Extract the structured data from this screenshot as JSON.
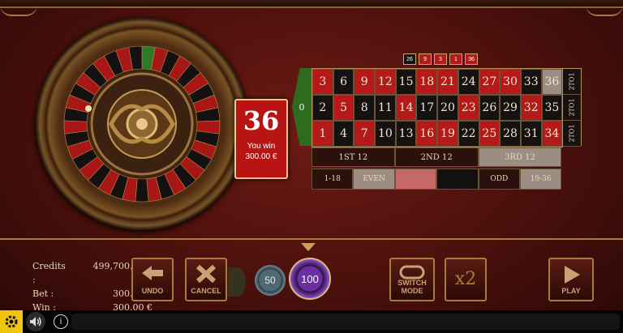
{
  "result": {
    "number": "36",
    "message": "You win",
    "amount": "300.00 €"
  },
  "history": [
    {
      "value": "26",
      "color": "#161211"
    },
    {
      "value": "9",
      "color": "#b51a1a"
    },
    {
      "value": "3",
      "color": "#b51a1a"
    },
    {
      "value": "1",
      "color": "#b51a1a"
    },
    {
      "value": "36",
      "color": "#b51a1a"
    }
  ],
  "table": {
    "zero": "0",
    "rows": [
      [
        {
          "n": "3",
          "c": "red"
        },
        {
          "n": "6",
          "c": "black"
        },
        {
          "n": "9",
          "c": "red"
        },
        {
          "n": "12",
          "c": "red"
        },
        {
          "n": "15",
          "c": "black"
        },
        {
          "n": "18",
          "c": "red"
        },
        {
          "n": "21",
          "c": "red"
        },
        {
          "n": "24",
          "c": "black"
        },
        {
          "n": "27",
          "c": "red"
        },
        {
          "n": "30",
          "c": "red"
        },
        {
          "n": "33",
          "c": "black"
        },
        {
          "n": "36",
          "c": "win"
        }
      ],
      [
        {
          "n": "2",
          "c": "black"
        },
        {
          "n": "5",
          "c": "red"
        },
        {
          "n": "8",
          "c": "black"
        },
        {
          "n": "11",
          "c": "black"
        },
        {
          "n": "14",
          "c": "red"
        },
        {
          "n": "17",
          "c": "black"
        },
        {
          "n": "20",
          "c": "black"
        },
        {
          "n": "23",
          "c": "red"
        },
        {
          "n": "26",
          "c": "black"
        },
        {
          "n": "29",
          "c": "black"
        },
        {
          "n": "32",
          "c": "red"
        },
        {
          "n": "35",
          "c": "black"
        }
      ],
      [
        {
          "n": "1",
          "c": "red"
        },
        {
          "n": "4",
          "c": "black"
        },
        {
          "n": "7",
          "c": "red"
        },
        {
          "n": "10",
          "c": "black"
        },
        {
          "n": "13",
          "c": "black"
        },
        {
          "n": "16",
          "c": "red"
        },
        {
          "n": "19",
          "c": "red"
        },
        {
          "n": "22",
          "c": "black"
        },
        {
          "n": "25",
          "c": "red"
        },
        {
          "n": "28",
          "c": "black"
        },
        {
          "n": "31",
          "c": "black"
        },
        {
          "n": "34",
          "c": "red"
        }
      ]
    ],
    "columns": [
      "2TO1",
      "2TO1",
      "2TO1"
    ],
    "dozens": [
      "1ST 12",
      "2ND 12",
      "3RD 12"
    ],
    "outside": [
      "1-18",
      "EVEN",
      "",
      "",
      "ODD",
      "19-36"
    ]
  },
  "stats": {
    "credits_label": "Credits :",
    "credits_value": "499,700.00 €",
    "bet_label": "Bet :",
    "bet_value": "300.00 €",
    "win_label": "Win :",
    "win_value": "300.00 €"
  },
  "controls": {
    "undo": "UNDO",
    "cancel": "CANCEL",
    "chip_50": "50",
    "chip_100": "100",
    "switch": "SWITCH MODE",
    "x2": "x2",
    "play": "PLAY"
  },
  "footer": {
    "info_icon": "i"
  },
  "colors": {
    "red": "#b51a1a",
    "black": "#161211",
    "green": "#2f6b1e",
    "gold": "#a57c3e"
  }
}
